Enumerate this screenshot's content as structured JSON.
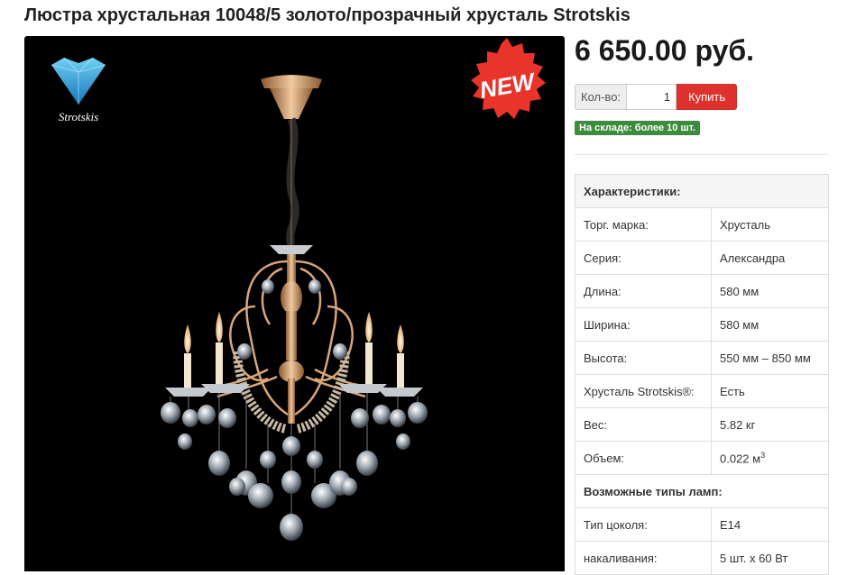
{
  "product": {
    "title": "Люстра хрустальная 10048/5 золото/прозрачный хрусталь Strotskis",
    "price": "6 650.00 руб.",
    "qty_label": "Кол-во:",
    "qty_value": "1",
    "buy_label": "Купить",
    "stock_badge": "На складе: более 10 шт."
  },
  "image": {
    "brand_logo_text": "Strotskis",
    "badge_text": "NEW",
    "badge_color": "#e8342b",
    "logo_color": "#2b9ed8"
  },
  "specs": {
    "header": "Характеристики:",
    "rows": [
      {
        "k": "Торг. марка:",
        "v": "Хрусталь"
      },
      {
        "k": "Серия:",
        "v": "Александра"
      },
      {
        "k": "Длина:",
        "v": "580 мм"
      },
      {
        "k": "Ширина:",
        "v": "580 мм"
      },
      {
        "k": "Высота:",
        "v": "550 мм – 850 мм"
      },
      {
        "k": "Хрусталь Strotskis®:",
        "v": "Есть"
      },
      {
        "k": "Вес:",
        "v": "5.82 кг"
      },
      {
        "k": "Объем:",
        "v": "0.022 м",
        "sup": "3"
      }
    ],
    "lamp_header": "Возможные типы ламп:",
    "lamp_rows": [
      {
        "k": "Тип цоколя:",
        "v": "E14"
      },
      {
        "k": "накаливания:",
        "v": "5 шт. x 60 Вт"
      }
    ]
  }
}
